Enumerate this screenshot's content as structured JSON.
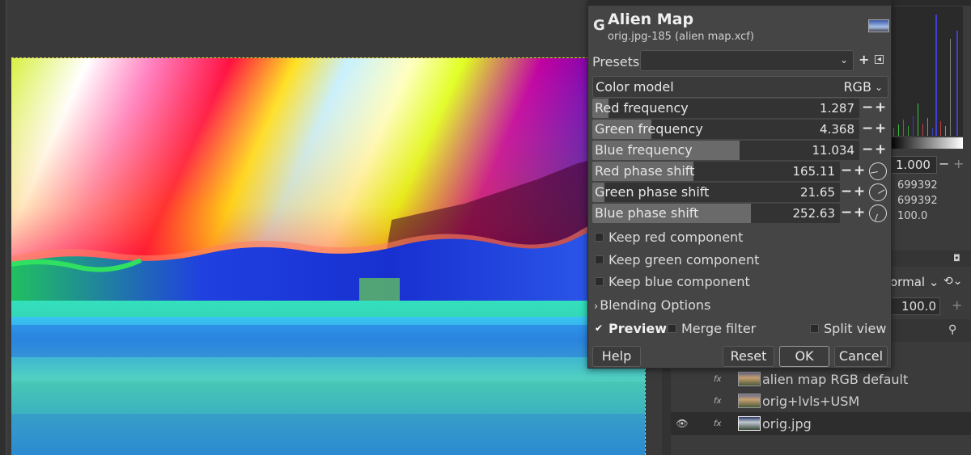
{
  "dialog": {
    "title": "Alien Map",
    "subtitle": "orig.jpg-185 (alien map.xcf)",
    "logo": "G",
    "presets_label": "Presets:",
    "presets_value": "",
    "color_model_label": "Color model",
    "color_model_value": "RGB",
    "sliders": [
      {
        "label": "Red frequency",
        "value": "1.287",
        "fraction": 0.06
      },
      {
        "label": "Green frequency",
        "value": "4.368",
        "fraction": 0.22
      },
      {
        "label": "Blue frequency",
        "value": "11.034",
        "fraction": 0.55
      },
      {
        "label": "Red phase shift",
        "value": "165.11",
        "fraction": 0.41
      },
      {
        "label": "Green phase shift",
        "value": "21.65",
        "fraction": 0.05
      },
      {
        "label": "Blue phase shift",
        "value": "252.63",
        "fraction": 0.64
      }
    ],
    "checks": [
      {
        "label": "Keep red component",
        "checked": false
      },
      {
        "label": "Keep green component",
        "checked": false
      },
      {
        "label": "Keep blue component",
        "checked": false
      }
    ],
    "blending_label": "Blending Options",
    "preview_label": "Preview",
    "preview_checked": true,
    "merge_label": "Merge filter",
    "split_label": "Split view",
    "buttons": {
      "help": "Help",
      "reset": "Reset",
      "ok": "OK",
      "cancel": "Cancel"
    }
  },
  "dock": {
    "gamma_value": "1.000",
    "info_lines": [
      "699392",
      "699392",
      "100.0"
    ],
    "mode_value": "ormal",
    "opacity_value": "100.0"
  },
  "layers": [
    {
      "name": "alien map RGB default",
      "fx": "fx",
      "visible": false
    },
    {
      "name": "orig+lvls+USM",
      "fx": "fx",
      "visible": false
    },
    {
      "name": "orig.jpg",
      "fx": "fx",
      "visible": true
    }
  ],
  "icons": {
    "minus": "−",
    "plus": "+",
    "chevron_down": "⌄",
    "chevron_right": "›",
    "check": "✔",
    "eye": "👁",
    "search": "⚲"
  },
  "colors": {
    "dialog_bg": "#454545",
    "slider_fill": "#6a6a6a",
    "canvas_bg": "#3a3a3a"
  }
}
